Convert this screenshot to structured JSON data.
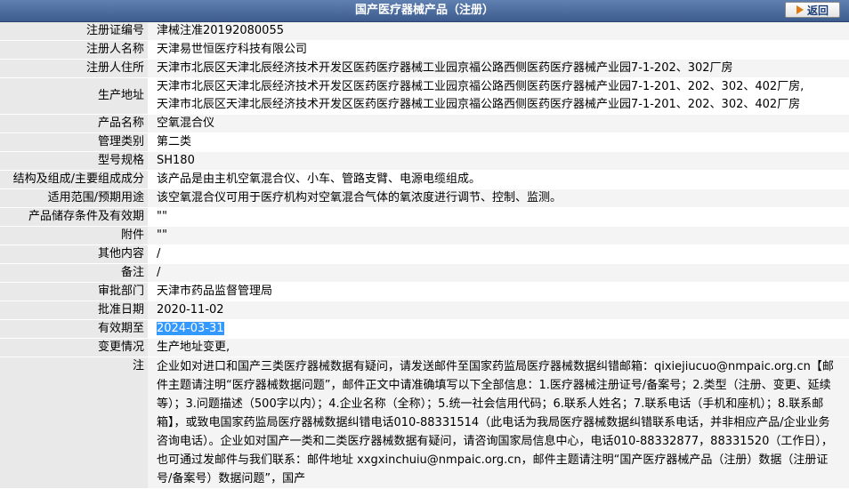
{
  "header": {
    "title": "国产医疗器械产品（注册）",
    "back_label": "返回"
  },
  "fields": [
    {
      "label": "注册证编号",
      "value": "津械注准20192080055"
    },
    {
      "label": "注册人名称",
      "value": "天津易世恒医疗科技有限公司"
    },
    {
      "label": "注册人住所",
      "value": "天津市北辰区天津北辰经济技术开发区医药医疗器械工业园京福公路西侧医药医疗器械产业园7-1-202、302厂房"
    },
    {
      "label": "生产地址",
      "value": "天津市北辰区天津北辰经济技术开发区医药医疗器械工业园京福公路西侧医药医疗器械产业园7-1-201、202、302、402厂房,",
      "value2": "天津市北辰区天津北辰经济技术开发区医药医疗器械工业园京福公路西侧医药医疗器械产业园7-1-201、202、302、402厂房"
    },
    {
      "label": "产品名称",
      "value": "空氧混合仪"
    },
    {
      "label": "管理类别",
      "value": "第二类"
    },
    {
      "label": "型号规格",
      "value": "SH180"
    },
    {
      "label": "结构及组成/主要组成成分",
      "value": "该产品是由主机空氧混合仪、小车、管路支臂、电源电缆组成。"
    },
    {
      "label": "适用范围/预期用途",
      "value": "该空氧混合仪可用于医疗机构对空氧混合气体的氧浓度进行调节、控制、监测。"
    },
    {
      "label": "产品储存条件及有效期",
      "value": "\"\""
    },
    {
      "label": "附件",
      "value": "\"\""
    },
    {
      "label": "其他内容",
      "value": "/"
    },
    {
      "label": "备注",
      "value": "/"
    },
    {
      "label": "审批部门",
      "value": "天津市药品监督管理局"
    },
    {
      "label": "批准日期",
      "value": "2020-11-02"
    },
    {
      "label": "有效期至",
      "value": "2024-03-31"
    },
    {
      "label": "变更情况",
      "value": "生产地址变更,"
    }
  ],
  "remark": {
    "label": "注",
    "text": "企业如对进口和国产三类医疗器械数据有疑问，请发送邮件至国家药监局医疗器械数据纠错邮箱：qixiejiucuo@nmpaic.org.cn【邮件主题请注明“医疗器械数据问题”，邮件正文中请准确填写以下全部信息：1.医疗器械注册证号/备案号；2.类型（注册、变更、延续等）；3.问题描述（500字以内）；4.企业名称（全称）；5.统一社会信用代码；6.联系人姓名；7.联系电话（手机和座机）；8.联系邮箱】，或致电国家药监局医疗器械数据纠错电话010-88331514（此电话为我局医疗器械数据纠错联系电话，并非相应产品/企业业务咨询电话）。企业如对国产一类和二类医疗器械数据有疑问，请咨询国家局信息中心，电话010-88332877，88331520（工作日），也可通过发邮件与我们联系：邮件地址 xxgxinchuiu@nmpaic.org.cn，邮件主题请注明“国产医疗器械产品（注册）数据（注册证号/备案号）数据问题”，国产"
  }
}
